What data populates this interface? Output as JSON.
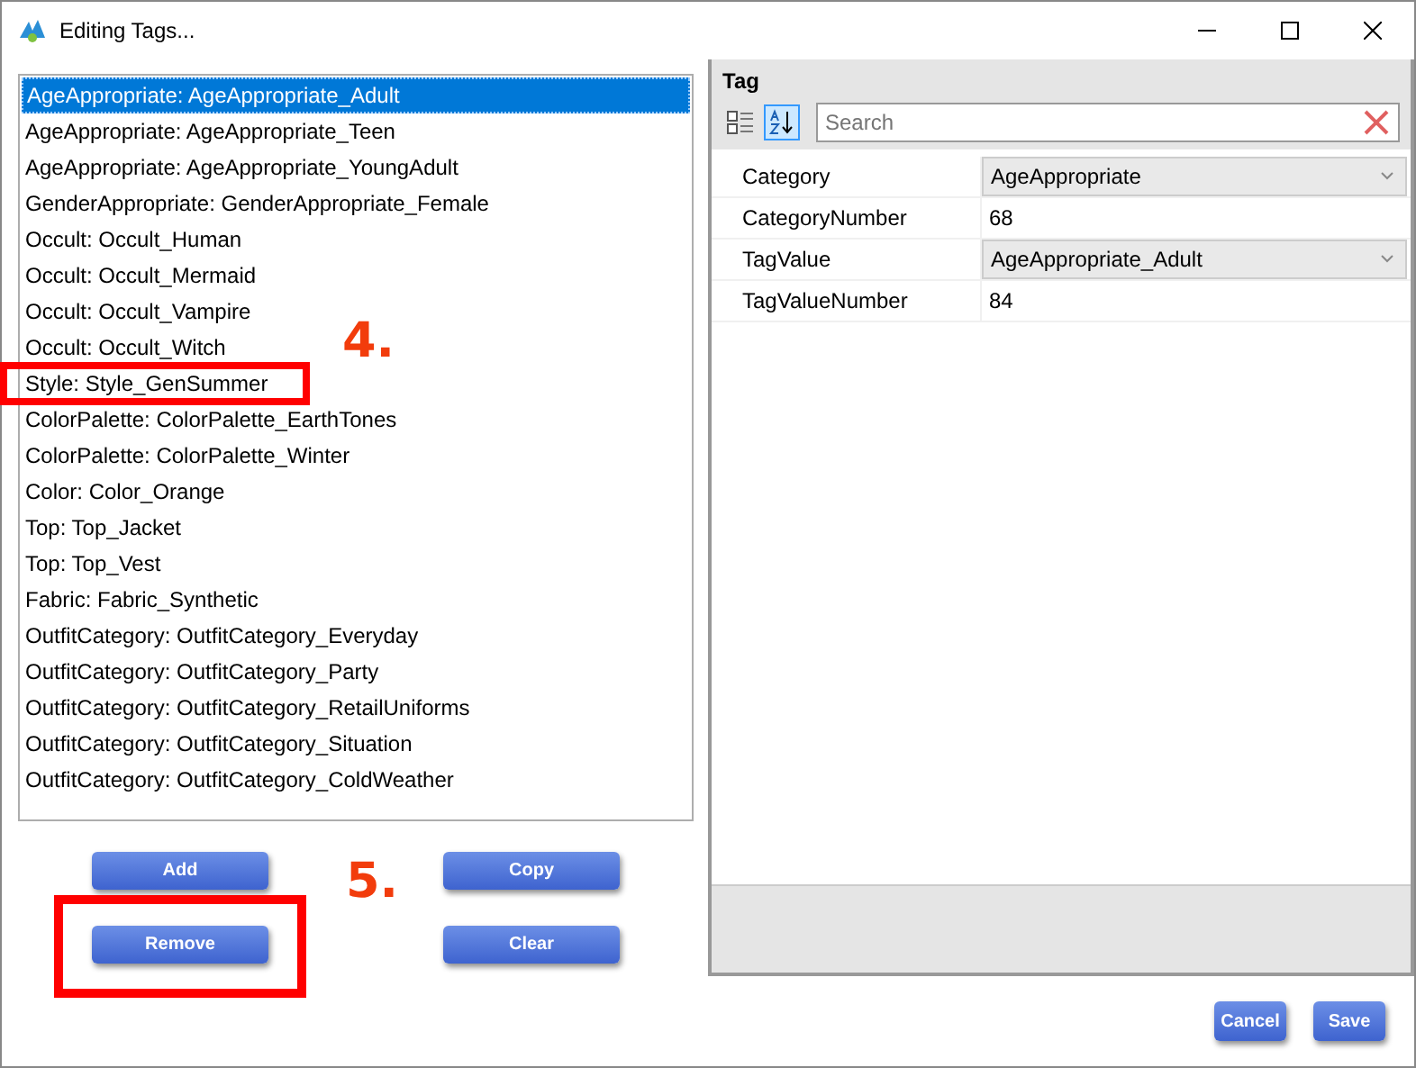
{
  "window": {
    "title": "Editing Tags..."
  },
  "tag_list": [
    {
      "text": "AgeAppropriate: AgeAppropriate_Adult",
      "selected": true
    },
    {
      "text": "AgeAppropriate: AgeAppropriate_Teen",
      "selected": false
    },
    {
      "text": "AgeAppropriate: AgeAppropriate_YoungAdult",
      "selected": false
    },
    {
      "text": "GenderAppropriate: GenderAppropriate_Female",
      "selected": false
    },
    {
      "text": "Occult: Occult_Human",
      "selected": false
    },
    {
      "text": "Occult: Occult_Mermaid",
      "selected": false
    },
    {
      "text": "Occult: Occult_Vampire",
      "selected": false
    },
    {
      "text": "Occult: Occult_Witch",
      "selected": false
    },
    {
      "text": "Style: Style_GenSummer",
      "selected": false
    },
    {
      "text": "ColorPalette: ColorPalette_EarthTones",
      "selected": false
    },
    {
      "text": "ColorPalette: ColorPalette_Winter",
      "selected": false
    },
    {
      "text": "Color: Color_Orange",
      "selected": false
    },
    {
      "text": "Top: Top_Jacket",
      "selected": false
    },
    {
      "text": "Top: Top_Vest",
      "selected": false
    },
    {
      "text": "Fabric: Fabric_Synthetic",
      "selected": false
    },
    {
      "text": "OutfitCategory: OutfitCategory_Everyday",
      "selected": false
    },
    {
      "text": "OutfitCategory: OutfitCategory_Party",
      "selected": false
    },
    {
      "text": "OutfitCategory: OutfitCategory_RetailUniforms",
      "selected": false
    },
    {
      "text": "OutfitCategory: OutfitCategory_Situation",
      "selected": false
    },
    {
      "text": "OutfitCategory: OutfitCategory_ColdWeather",
      "selected": false
    }
  ],
  "list_buttons": [
    "Add",
    "Copy",
    "Remove",
    "Clear"
  ],
  "property_grid": {
    "title": "Tag",
    "search": {
      "placeholder": "Search"
    },
    "properties": [
      {
        "name": "Category",
        "value": "AgeAppropriate",
        "kind": "dropdown"
      },
      {
        "name": "CategoryNumber",
        "value": "68",
        "kind": "text"
      },
      {
        "name": "TagValue",
        "value": "AgeAppropriate_Adult",
        "kind": "dropdown"
      },
      {
        "name": "TagValueNumber",
        "value": "84",
        "kind": "text"
      }
    ]
  },
  "dialog_buttons": [
    "Cancel",
    "Save"
  ],
  "annotations": [
    {
      "label": "4."
    },
    {
      "label": "5."
    }
  ]
}
